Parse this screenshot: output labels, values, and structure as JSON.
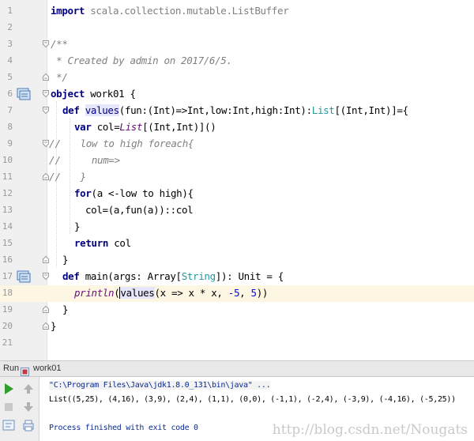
{
  "editor": {
    "lines": [
      {
        "n": "1"
      },
      {
        "n": "2"
      },
      {
        "n": "3"
      },
      {
        "n": "4"
      },
      {
        "n": "5"
      },
      {
        "n": "6"
      },
      {
        "n": "7"
      },
      {
        "n": "8"
      },
      {
        "n": "9"
      },
      {
        "n": "10"
      },
      {
        "n": "11"
      },
      {
        "n": "12"
      },
      {
        "n": "13"
      },
      {
        "n": "14"
      },
      {
        "n": "15"
      },
      {
        "n": "16"
      },
      {
        "n": "17"
      },
      {
        "n": "18"
      },
      {
        "n": "19"
      },
      {
        "n": "20"
      },
      {
        "n": "21"
      }
    ],
    "t": {
      "import_kw": "import",
      "import_path": " scala.collection.mutable.ListBuffer",
      "doc_open": "/**",
      "doc_line": " * Created by admin on 2017/6/5.",
      "doc_close": " */",
      "object_kw": "object",
      "object_name": " work01 {",
      "def_kw": "def",
      "values_name": "values",
      "values_sig_a": "(fun:(Int)=>Int,low:Int,high:Int):",
      "list_type": "List",
      "values_sig_b": "[(Int,Int)]={",
      "var_kw": "var",
      "var_a": " col=",
      "list_ctor": "List",
      "var_b": "[(Int,Int)]()",
      "cmt9_mark": "//",
      "cmt9": "   low to high foreach{",
      "cmt10_mark": "//",
      "cmt10": "     num=>",
      "cmt11_mark": "//",
      "cmt11": "   }",
      "for_kw": "for",
      "for_rest": "(a <-low to high){",
      "col_assign": "col=(a,fun(a))::col",
      "close_brace": "}",
      "return_kw": "return",
      "return_rest": " col",
      "main_a": " main(args: Array[",
      "string_type": "String",
      "main_b": "]): Unit = {",
      "println": "println",
      "call_paren": "(",
      "call_v": "v",
      "call_alues": "alues",
      "call_args": "(x => x * x, ",
      "num_neg5": "-5",
      "comma": ", ",
      "num_5": "5",
      "call_end": "))"
    }
  },
  "run": {
    "label": "Run",
    "tab": "work01",
    "command": "\"C:\\Program Files\\Java\\jdk1.8.0_131\\bin\\java\" ...",
    "output": "List((5,25), (4,16), (3,9), (2,4), (1,1), (0,0), (-1,1), (-2,4), (-3,9), (-4,16), (-5,25))",
    "finished": "Process finished with exit code 0",
    "watermark": "http://blog.csdn.net/Nougats"
  },
  "colors": {
    "keyword": "#000080",
    "type": "#20999d",
    "comment": "#808080",
    "number": "#0000ff",
    "current_line": "#fcf6e3",
    "run_green": "#2f9e2f"
  },
  "icons": {
    "gutter": [
      "object-icon",
      "method-override-icon"
    ],
    "toolbar": [
      "run-icon",
      "up-arrow-icon",
      "stop-icon",
      "down-arrow-icon",
      "wrap-icon",
      "print-icon"
    ]
  }
}
